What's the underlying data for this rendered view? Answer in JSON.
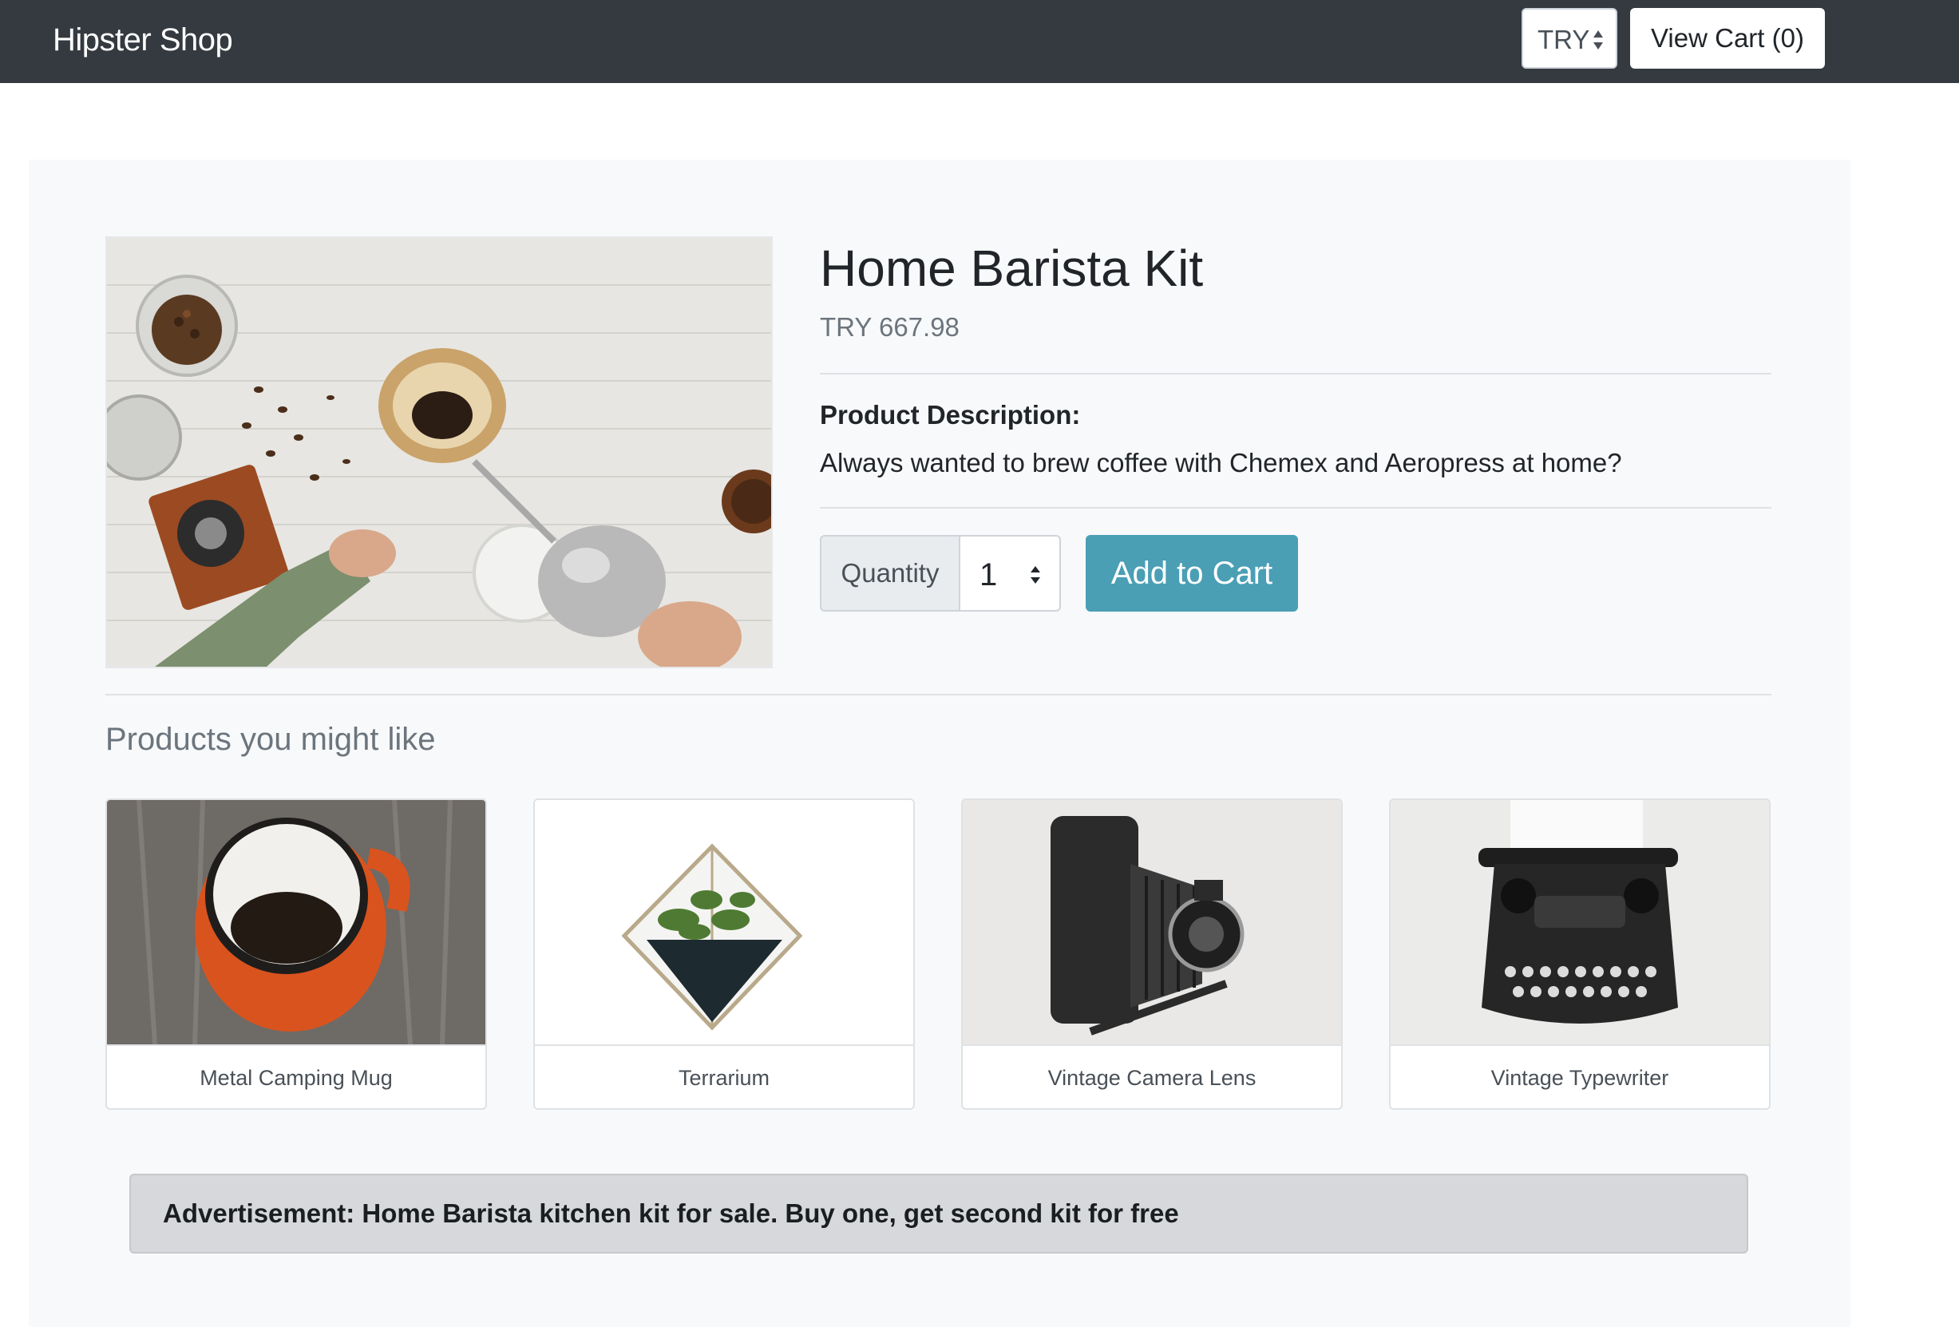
{
  "header": {
    "brand": "Hipster Shop",
    "currency": "TRY",
    "view_cart": "View Cart (0)"
  },
  "product": {
    "name": "Home Barista Kit",
    "price": "TRY 667.98",
    "description_heading": "Product Description:",
    "description": "Always wanted to brew coffee with Chemex and Aeropress at home?",
    "quantity_label": "Quantity",
    "quantity_value": "1",
    "add_to_cart": "Add to Cart",
    "image_icon": "coffee-brewing-photo"
  },
  "recommendations": {
    "title": "Products you might like",
    "items": [
      {
        "name": "Metal Camping Mug",
        "icon": "mug-photo"
      },
      {
        "name": "Terrarium",
        "icon": "terrarium-photo"
      },
      {
        "name": "Vintage Camera Lens",
        "icon": "camera-photo"
      },
      {
        "name": "Vintage Typewriter",
        "icon": "typewriter-photo"
      }
    ]
  },
  "advertisement": {
    "text": "Advertisement: Home Barista kitchen kit for sale. Buy one, get second kit for free"
  },
  "colors": {
    "navbar": "#343a40",
    "accent_button": "#4a9fb5",
    "panel": "#f8f9fa"
  }
}
